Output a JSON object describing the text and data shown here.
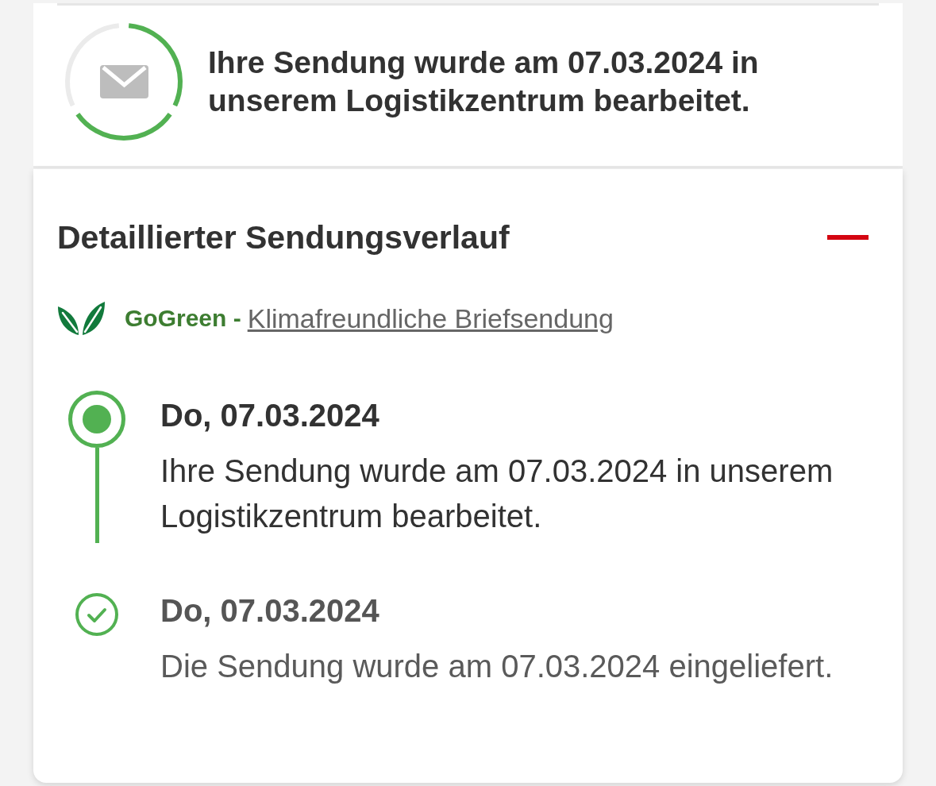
{
  "status": {
    "ring": {
      "segments": [
        {
          "done": true
        },
        {
          "done": true
        },
        {
          "done": false
        }
      ]
    },
    "message": "Ihre Sendung wurde am 07.03.2024 in unserem Logistikzentrum bearbeitet."
  },
  "history": {
    "title": "Detaillierter Sendungsverlauf",
    "expanded": true,
    "gogreen": {
      "label": "GoGreen -",
      "link": "Klimafreundliche Briefsendung"
    },
    "events": [
      {
        "date": "Do, 07.03.2024",
        "text": "Ihre Sendung wurde am 07.03.2024 in unserem Logistikzentrum bearbeitet.",
        "current": true
      },
      {
        "date": "Do, 07.03.2024",
        "text": "Die Sendung wurde am 07.03.2024 eingeliefert.",
        "current": false
      }
    ]
  }
}
